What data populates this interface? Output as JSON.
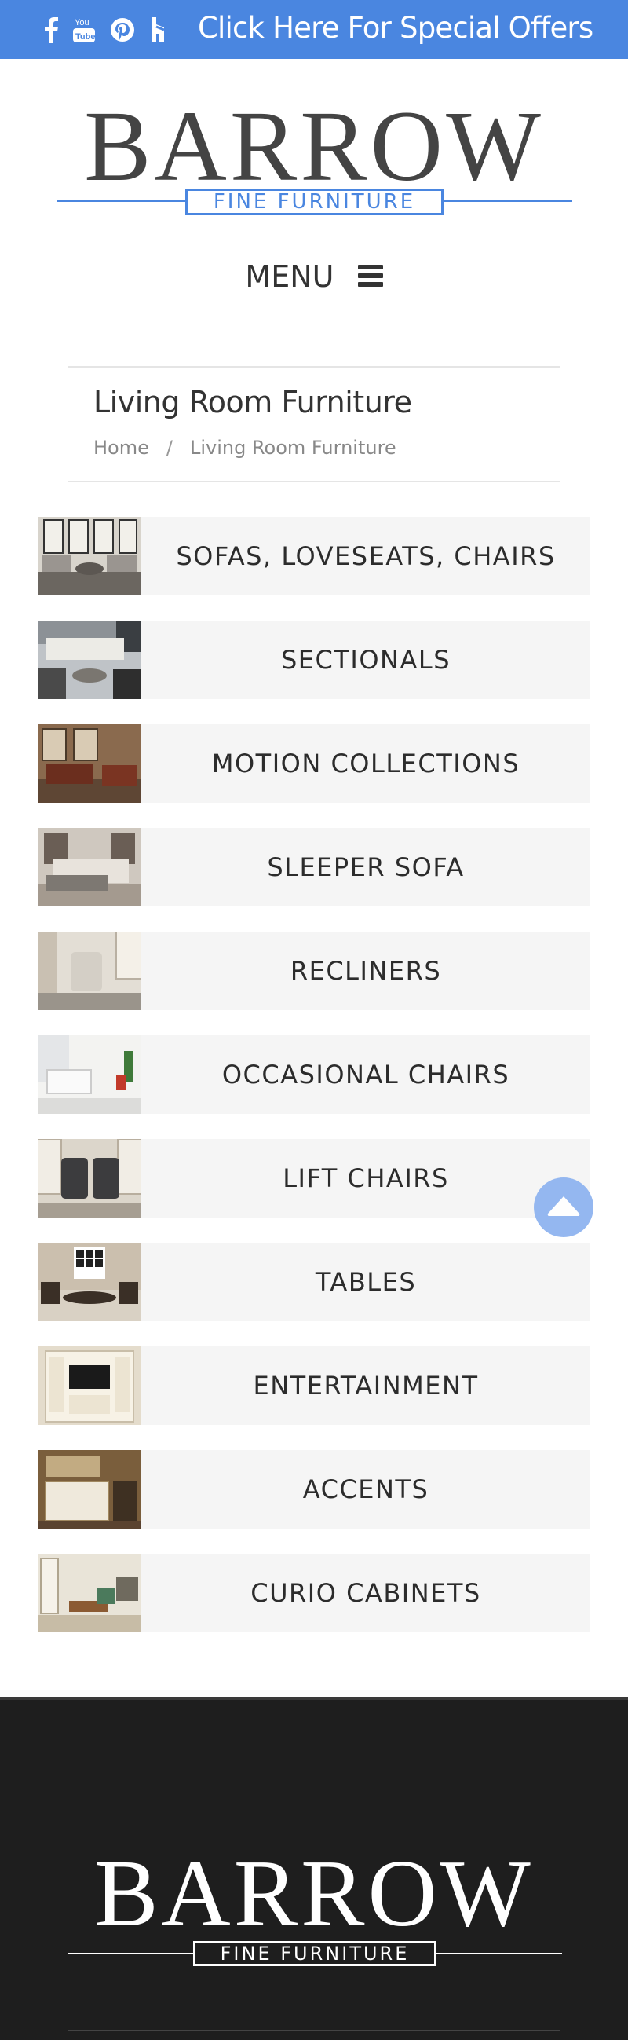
{
  "topbar": {
    "social_icons": [
      "facebook-icon",
      "youtube-icon",
      "pinterest-icon",
      "houzz-icon"
    ],
    "offers_link": "Click Here For Special Offers",
    "accent_color": "#4a86e0"
  },
  "logo": {
    "brand": "BARROW",
    "tagline": "FINE FURNITURE"
  },
  "menu": {
    "label": "MENU",
    "icon": "hamburger-icon"
  },
  "page": {
    "title": "Living Room Furniture",
    "breadcrumb": [
      "Home",
      "Living Room Furniture"
    ]
  },
  "categories": [
    {
      "label": "SOFAS, LOVESEATS, CHAIRS"
    },
    {
      "label": "SECTIONALS"
    },
    {
      "label": "MOTION COLLECTIONS"
    },
    {
      "label": "SLEEPER SOFA"
    },
    {
      "label": "RECLINERS"
    },
    {
      "label": "OCCASIONAL CHAIRS"
    },
    {
      "label": "LIFT CHAIRS"
    },
    {
      "label": "TABLES"
    },
    {
      "label": "ENTERTAINMENT"
    },
    {
      "label": "ACCENTS"
    },
    {
      "label": "CURIO CABINETS"
    }
  ],
  "scroll_top": {
    "icon": "arrow-up-icon"
  },
  "footer": {
    "brand": "BARROW",
    "tagline": "FINE FURNITURE"
  }
}
